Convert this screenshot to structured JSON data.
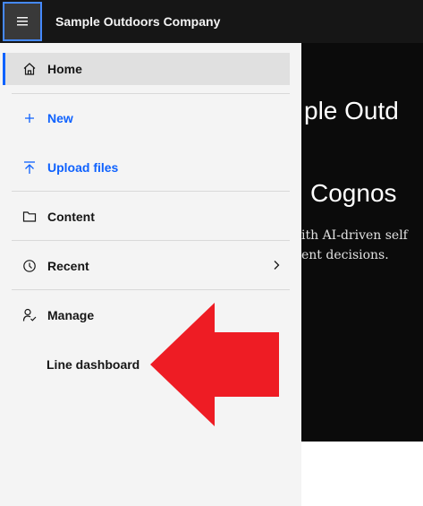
{
  "header": {
    "menu_icon": "hamburger-menu-icon",
    "brand": "Sample Outdoors Company"
  },
  "sidebar": {
    "items": [
      {
        "label": "Home",
        "icon": "home-icon"
      },
      {
        "label": "New",
        "icon": "plus-icon"
      },
      {
        "label": "Upload files",
        "icon": "upload-icon"
      },
      {
        "label": "Content",
        "icon": "folder-icon"
      },
      {
        "label": "Recent",
        "icon": "clock-icon"
      },
      {
        "label": "Manage",
        "icon": "manage-user-icon"
      }
    ],
    "sub_item": "Line dashboard"
  },
  "hero": {
    "title": "ple Outd",
    "subtitle": "Cognos",
    "desc_line1": "ith AI-driven self",
    "desc_line2": "ent decisions."
  },
  "annotation": {
    "arrow_color": "#ee1c24"
  },
  "colors": {
    "accent": "#0f62fe",
    "topbar": "#161616"
  }
}
